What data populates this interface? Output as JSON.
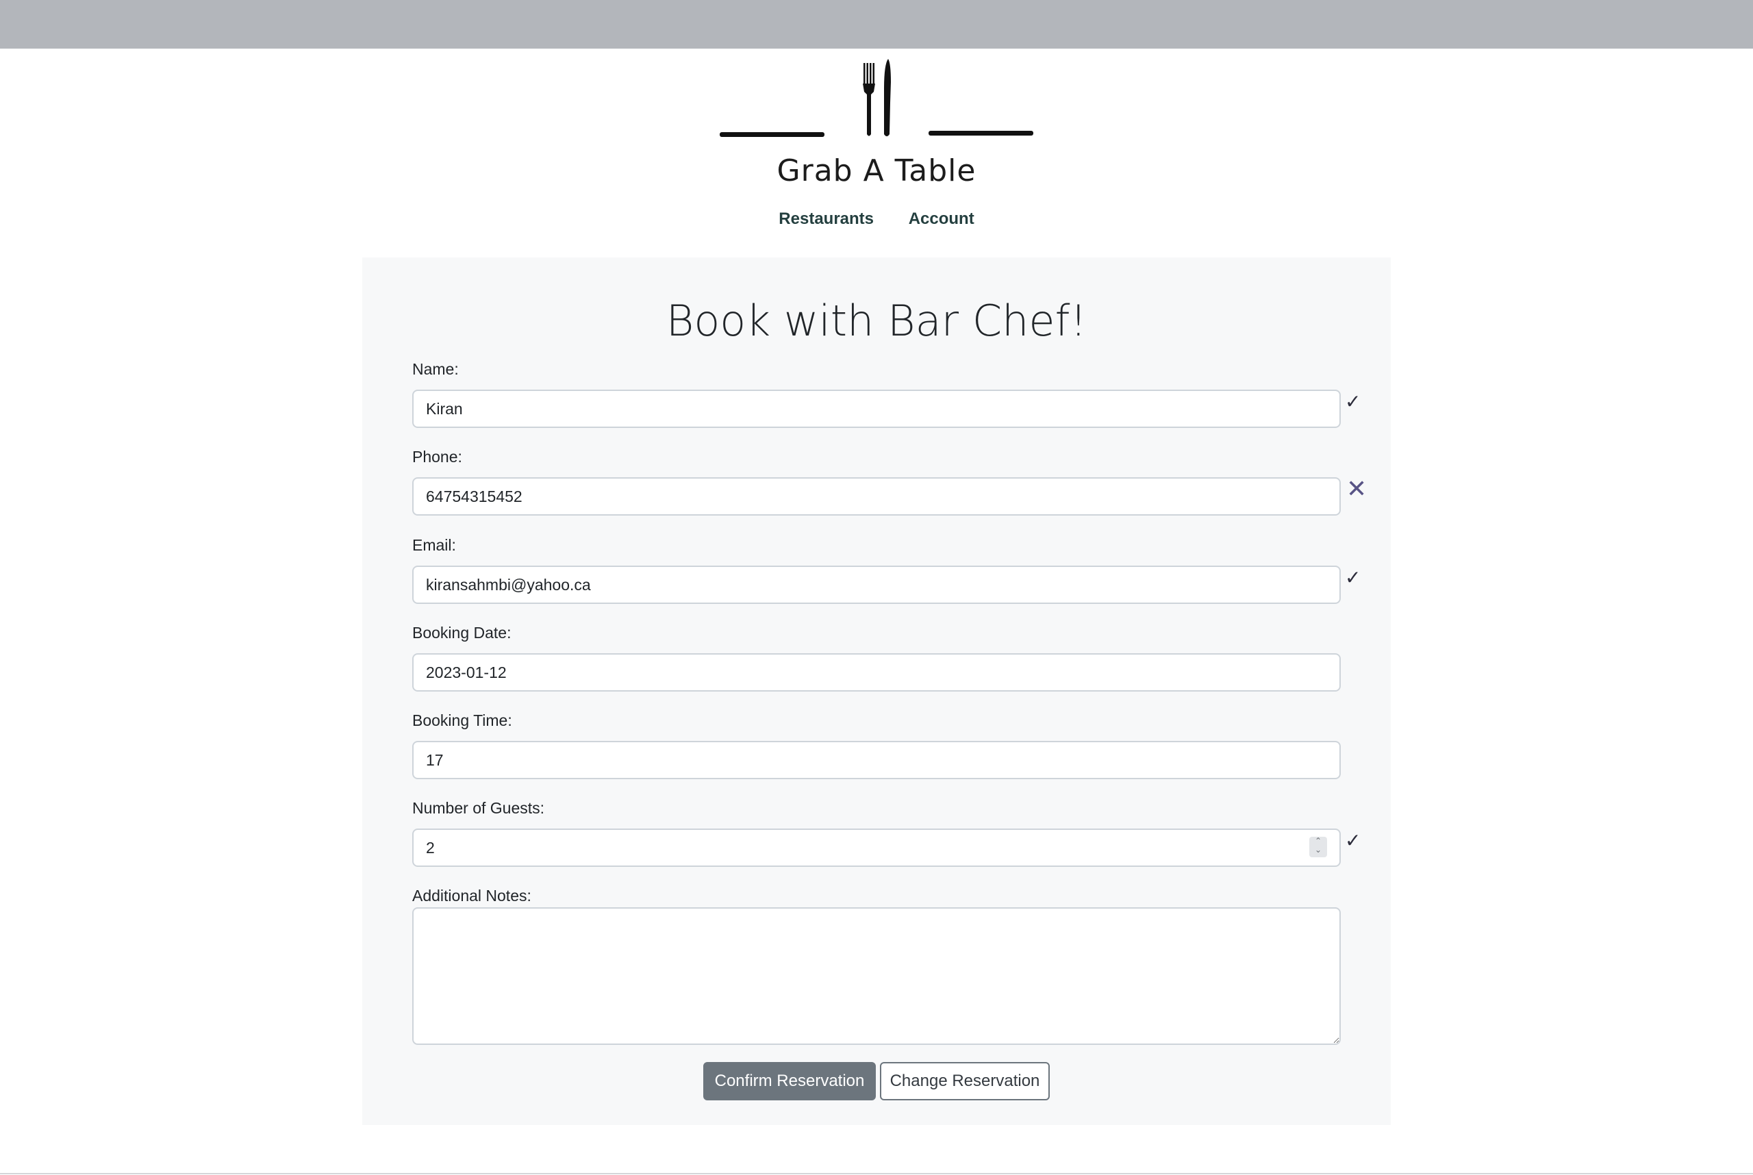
{
  "header": {
    "brand_name": "Grab A Table"
  },
  "nav": {
    "items": [
      {
        "label": "Restaurants"
      },
      {
        "label": "Account"
      }
    ]
  },
  "form": {
    "title": "Book with Bar Chef!",
    "fields": {
      "name": {
        "label": "Name:",
        "value": "Kiran",
        "status": "valid"
      },
      "phone": {
        "label": "Phone:",
        "value": "64754315452",
        "status": "invalid"
      },
      "email": {
        "label": "Email:",
        "value": "kiransahmbi@yahoo.ca",
        "status": "valid"
      },
      "booking_date": {
        "label": "Booking Date:",
        "value": "2023-01-12"
      },
      "booking_time": {
        "label": "Booking Time:",
        "value": "17"
      },
      "guests": {
        "label": "Number of Guests:",
        "value": "2",
        "status": "valid"
      },
      "notes": {
        "label": "Additional Notes:",
        "value": ""
      }
    },
    "valid_mark": "✓",
    "invalid_mark": "✕",
    "buttons": {
      "confirm": "Confirm Reservation",
      "change": "Change Reservation"
    }
  },
  "colors": {
    "top_bar": "#b3b6bb",
    "panel": "#f7f8f9",
    "nav_text": "#243f3f",
    "primary_button": "#6c757d",
    "invalid_mark": "#585486"
  }
}
